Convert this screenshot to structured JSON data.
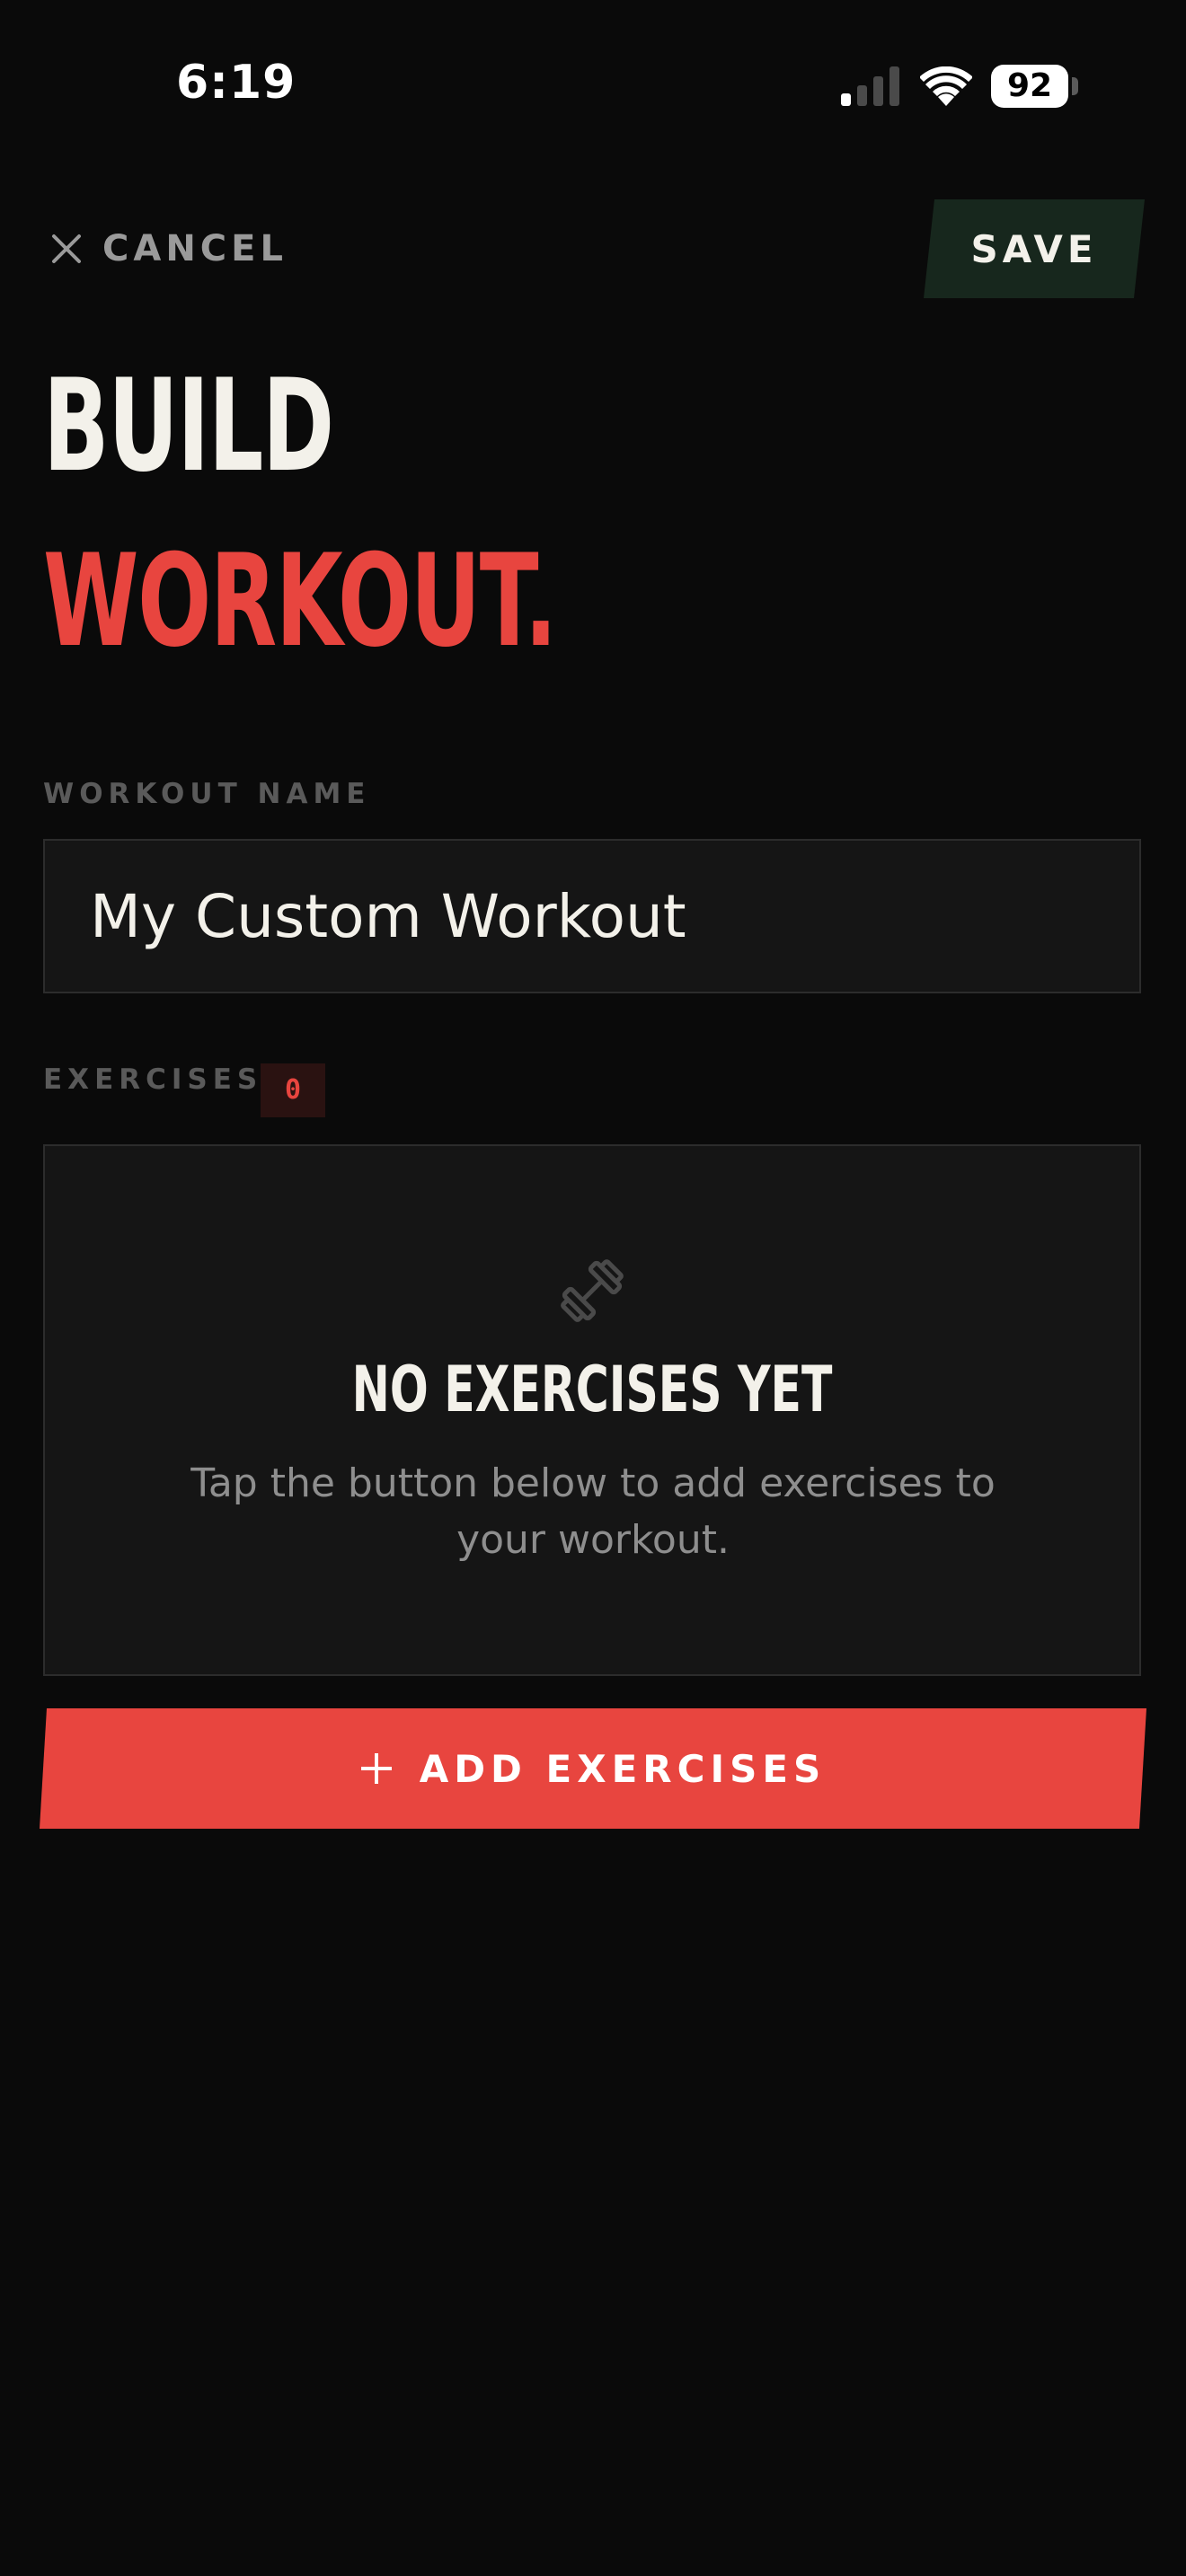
{
  "status_bar": {
    "time": "6:19",
    "battery_percent": "92",
    "signal_bars_active": 1,
    "signal_bars_total": 4
  },
  "header": {
    "cancel_label": "CANCEL",
    "save_label": "SAVE"
  },
  "title": {
    "line1": "BUILD",
    "line2": "WORKOUT."
  },
  "workout_name": {
    "label": "WORKOUT NAME",
    "value": "My Custom Workout"
  },
  "exercises": {
    "label": "EXERCISES",
    "count": "0",
    "empty_title": "NO EXERCISES YET",
    "empty_body": "Tap the button below to add exercises to your workout."
  },
  "add_button": {
    "label": "ADD EXERCISES"
  },
  "icons": {
    "cancel": "close-icon",
    "empty_state": "dumbbell-icon",
    "add": "plus-icon"
  },
  "colors": {
    "background": "#0a0a0a",
    "accent": "#e8453f",
    "save_bg": "#17271d",
    "panel_bg": "#151515",
    "text_primary": "#f3f1ea",
    "text_muted": "#5a5a5a"
  }
}
